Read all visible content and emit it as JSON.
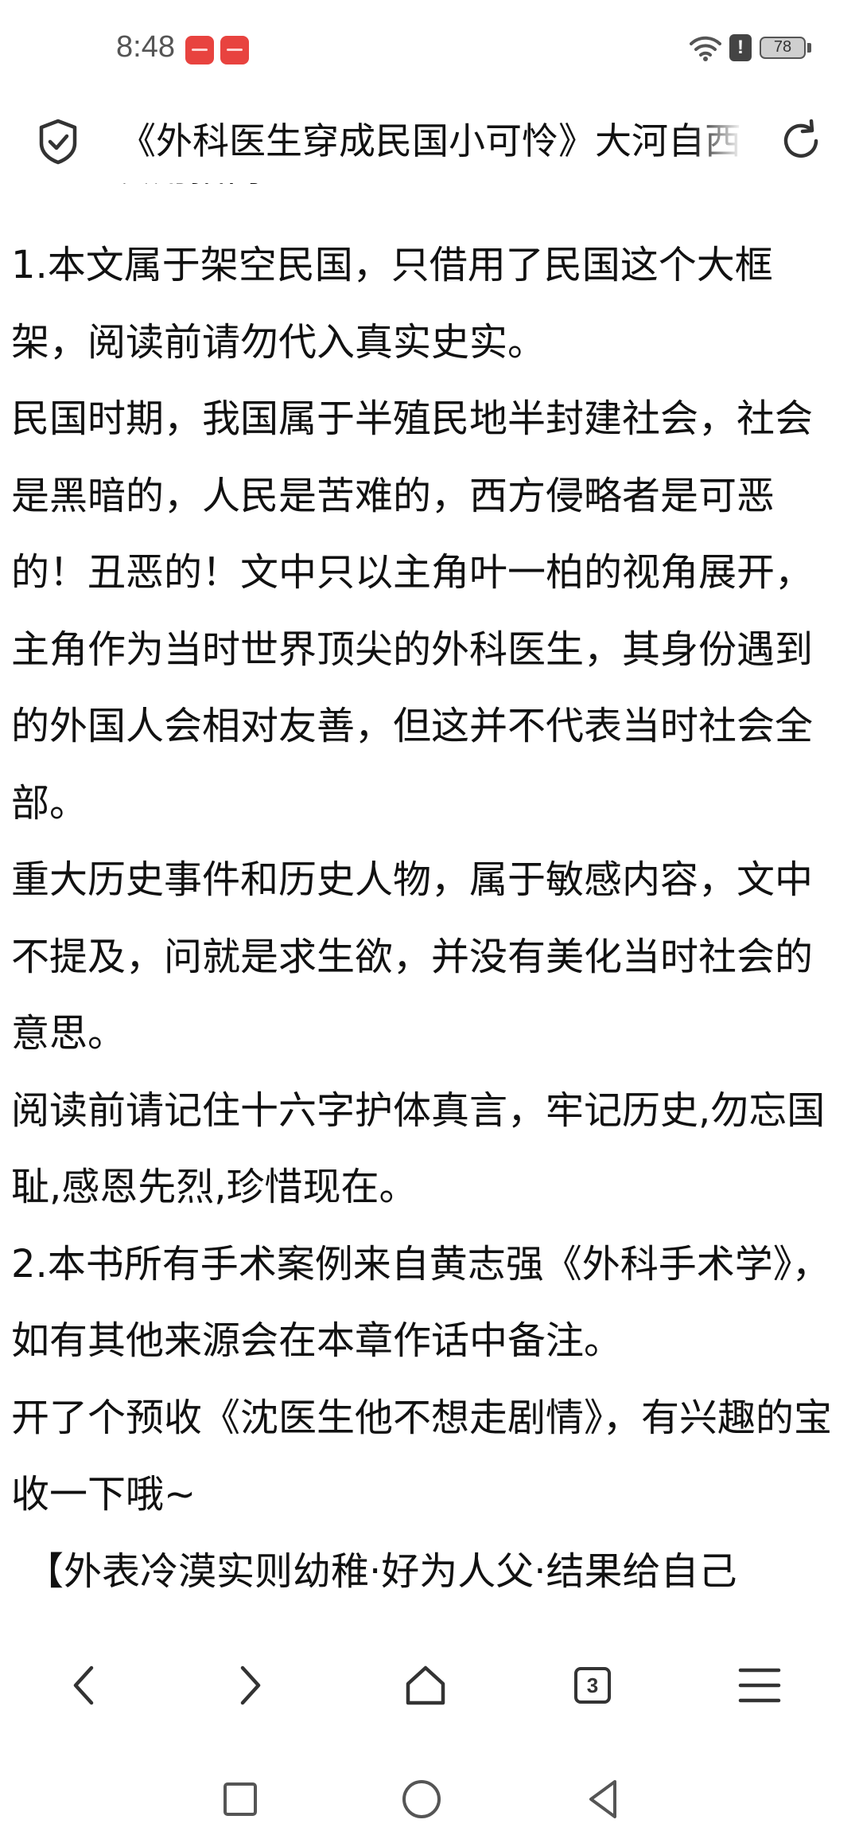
{
  "status": {
    "time": "8:48",
    "battery": "78",
    "alert": "!",
    "app_badges": [
      "huawei-app-badge",
      "huawei-app-badge"
    ]
  },
  "header": {
    "title": "《外科医生穿成民国小可怜》大河自西"
  },
  "content": {
    "partial_heading": "食用指南",
    "paragraphs": [
      "1.本文属于架空民国，只借用了民国这个大框架，阅读前请勿代入真实史实。",
      "民国时期，我国属于半殖民地半封建社会，社会是黑暗的，人民是苦难的，西方侵略者是可恶的！丑恶的！文中只以主角叶一柏的视角展开，主角作为当时世界顶尖的外科医生，其身份遇到的外国人会相对友善，但这并不代表当时社会全部。",
      "重大历史事件和历史人物，属于敏感内容，文中不提及，问就是求生欲，并没有美化当时社会的意思。",
      "阅读前请记住十六字护体真言，牢记历史,勿忘国耻,感恩先烈,珍惜现在。",
      "2.本书所有手术案例来自黄志强《外科手术学》，如有其他来源会在本章作话中备注。",
      "开了个预收《沈医生他不想走剧情》，有兴趣的宝收一下哦~",
      "【外表冷漠实则幼稚·好为人父·结果给自己"
    ]
  },
  "toolbar": {
    "tabs_count": "3",
    "icons": [
      "back-icon",
      "forward-icon",
      "home-icon",
      "tabs-icon",
      "menu-icon"
    ]
  },
  "system_nav": {
    "icons": [
      "recent-apps-icon",
      "home-circle-icon",
      "back-triangle-icon"
    ]
  },
  "colors": {
    "badge": "#e8433f",
    "text": "#111111",
    "icon": "#333333"
  }
}
